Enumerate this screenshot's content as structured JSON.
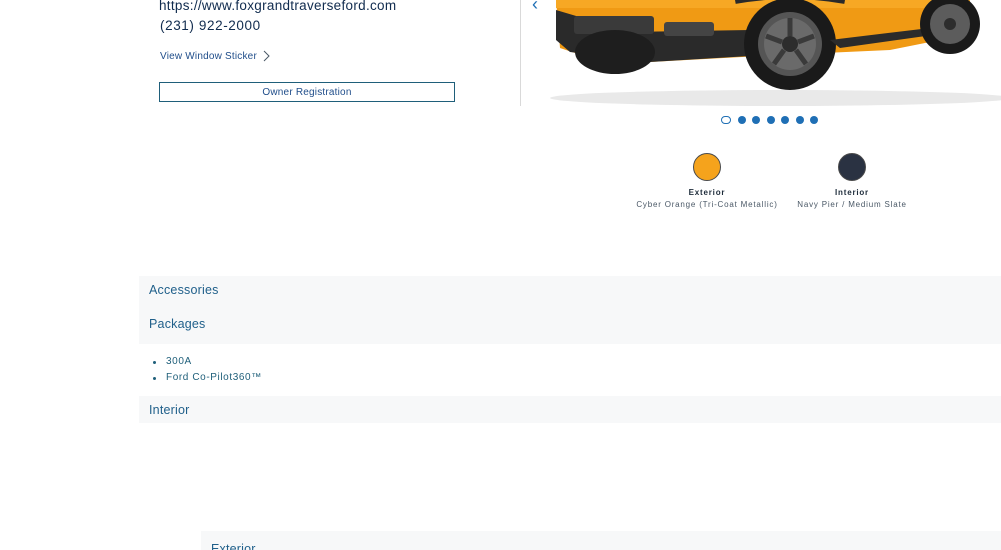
{
  "dealer": {
    "website": "https://www.foxgrandtraverseford.com",
    "phone": "(231) 922-2000",
    "window_sticker_label": "View Window Sticker",
    "owner_registration_label": "Owner Registration"
  },
  "carousel": {
    "dot_count": 7,
    "active_index": 0
  },
  "colors": {
    "exterior": {
      "label": "Exterior",
      "name": "Cyber Orange (Tri-Coat Metallic)",
      "hex": "#f5a31c"
    },
    "interior": {
      "label": "Interior",
      "name": "Navy Pier / Medium Slate",
      "hex": "#2a3242"
    }
  },
  "sections": {
    "accessories": "Accessories",
    "packages": "Packages",
    "package_items": [
      "300A",
      "Ford Co-Pilot360™"
    ],
    "interior": "Interior",
    "exterior": "Exterior"
  },
  "icons": {
    "window_sticker": "chevron-right-icon",
    "carousel_prev": "chevron-left-icon"
  },
  "theme": {
    "accent": "#1f6fb5",
    "text": "#102b4e",
    "section_bg": "#f7f8f9"
  }
}
